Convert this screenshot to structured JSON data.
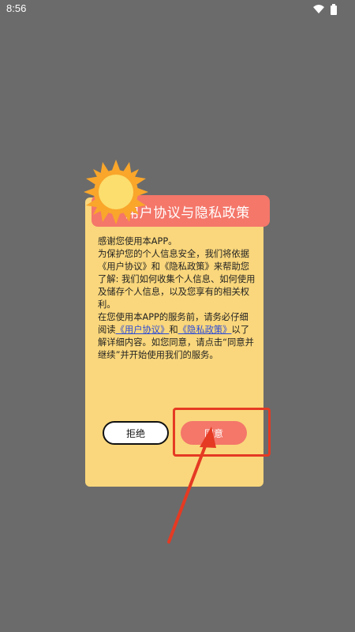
{
  "status_bar": {
    "time": "8:56"
  },
  "dialog": {
    "title": "用户协议与隐私政策",
    "para1": "感谢您使用本APP。",
    "para2": "为保护您的个人信息安全，我们将依据《用户协议》和《隐私政策》来帮助您了解: 我们如何收集个人信息、如何使用及储存个人信息，以及您享有的相关权利。",
    "para3_prefix": "在您使用本APP的服务前，请务必仔细阅读",
    "link_user_agreement": "《用户协议》",
    "para3_and": "和",
    "link_privacy_policy": "《隐私政策》",
    "para3_suffix": "以了解详细内容。如您同意，请点击“同意并继续”并开始使用我们的服务。",
    "decline_label": "拒绝",
    "agree_label": "同意"
  },
  "colors": {
    "backdrop": "#6b6b6b",
    "dialog_bg": "#fad77c",
    "accent": "#f4776a",
    "link": "#2b4bd6",
    "annotation": "#e53a23"
  },
  "icons": [
    "wifi-icon",
    "battery-icon",
    "sun-icon",
    "arrow-annotation"
  ]
}
